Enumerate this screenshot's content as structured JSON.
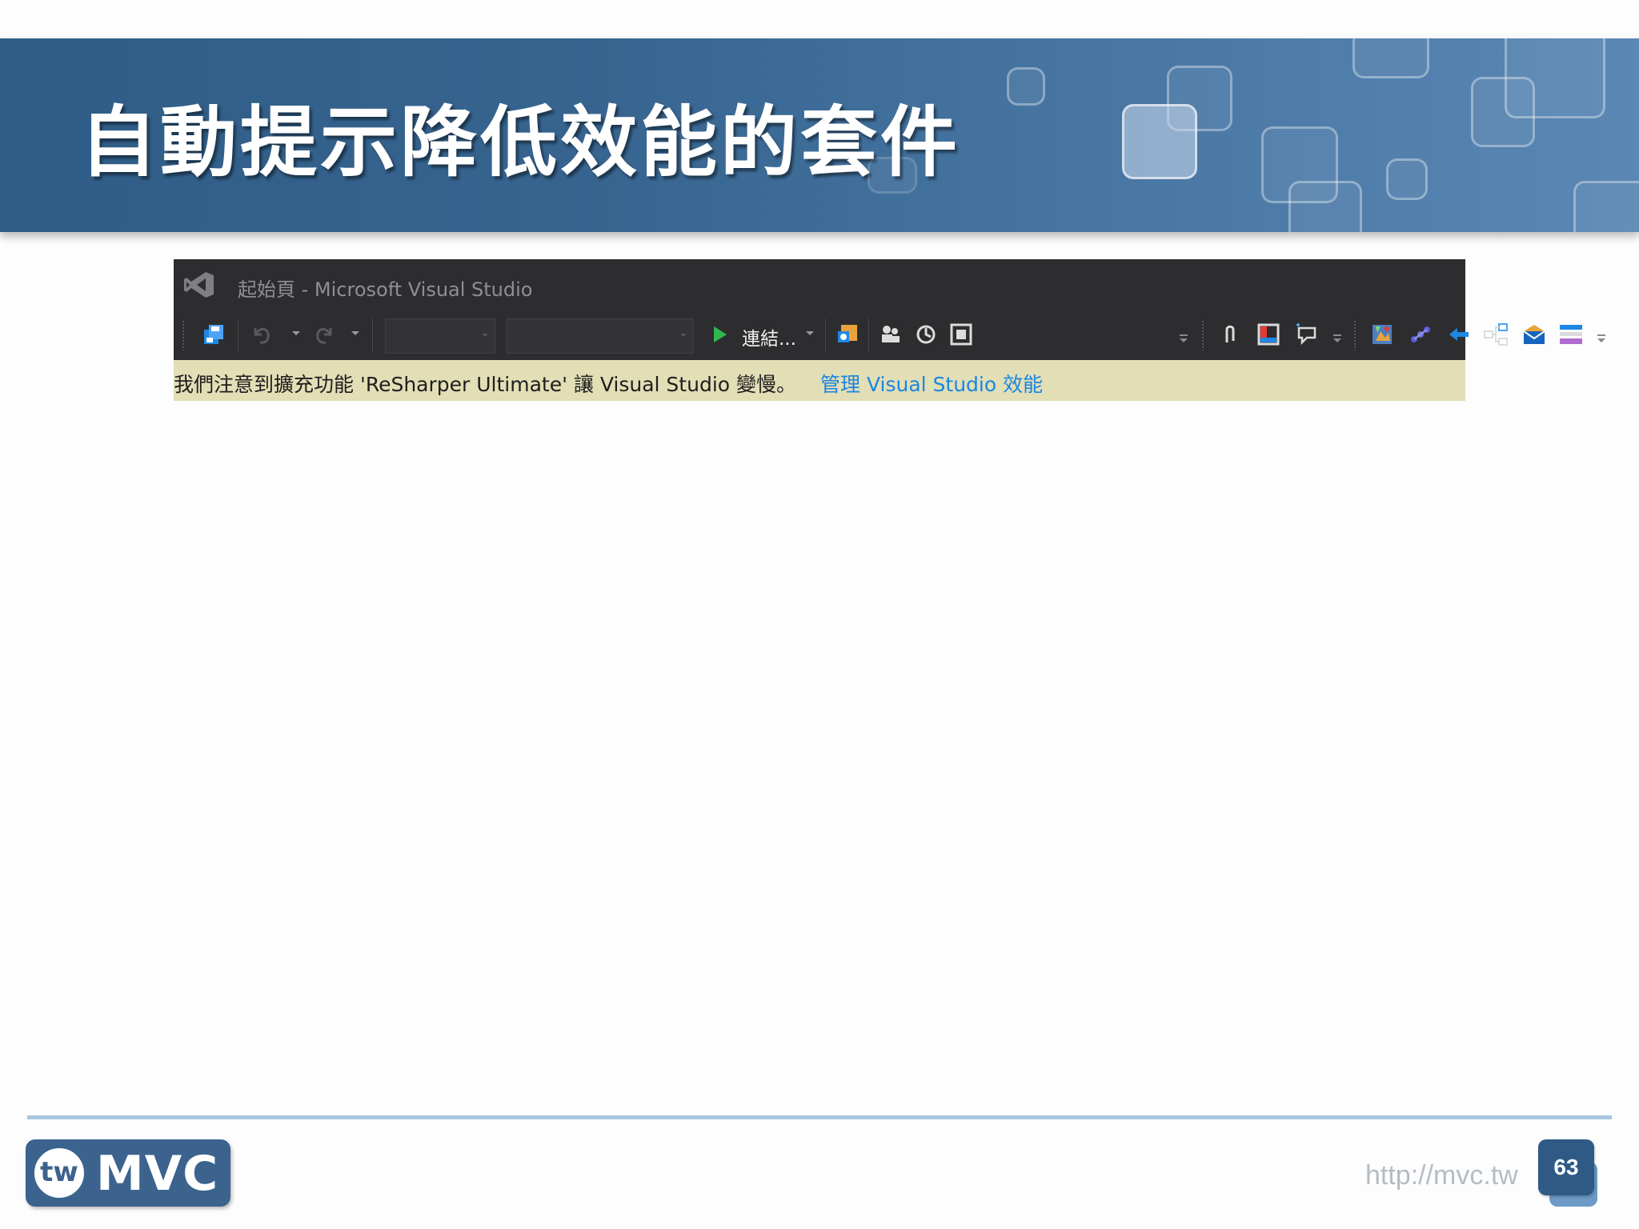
{
  "slide": {
    "title": "自動提示降低效能的套件"
  },
  "vs_window": {
    "title": "起始頁 - Microsoft Visual Studio",
    "toolbar": {
      "run_label": "連結...",
      "icons": [
        "save-all-icon",
        "undo-icon",
        "redo-icon",
        "start-run-icon",
        "browser-link-icon",
        "team-explorer-icon",
        "refresh-icon",
        "code-map-icon",
        "attach-icon",
        "window-layout-icon",
        "comment-icon",
        "image-editor-icon",
        "dependency-icon",
        "back-arrow-icon",
        "hierarchy-icon",
        "mail-icon",
        "layout-bars-icon"
      ]
    },
    "infobar": {
      "message": "我們注意到擴充功能 'ReSharper Ultimate' 讓 Visual Studio 變慢。",
      "link": "管理 Visual Studio 效能",
      "background_color": "#e2deb6",
      "link_color": "#1a86e0"
    }
  },
  "footer": {
    "logo_tw": "tw",
    "logo_mvc": "MVC",
    "url": "http://mvc.tw",
    "page_number": "63"
  },
  "colors": {
    "banner": "#36648f",
    "vs_chrome": "#2d2d30",
    "footer_rule": "#a8c6df",
    "page_badge": "#2f5a85"
  }
}
